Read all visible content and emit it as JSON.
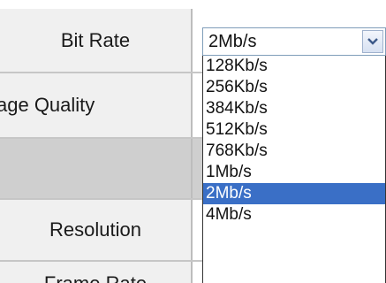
{
  "rows": {
    "bit_rate": {
      "label": "Bit Rate"
    },
    "image_quality": {
      "label": "age Quality"
    },
    "blank": {
      "label": ""
    },
    "resolution": {
      "label": "Resolution"
    },
    "frame_rate": {
      "label": "Frame Rate"
    }
  },
  "bit_rate_select": {
    "value": "2Mb/s",
    "options": [
      "128Kb/s",
      "256Kb/s",
      "384Kb/s",
      "512Kb/s",
      "768Kb/s",
      "1Mb/s",
      "2Mb/s",
      "4Mb/s"
    ],
    "selected_index": 6
  },
  "colors": {
    "selected_option_bg": "#3a6fc6",
    "label_bg": "#f0f0f0",
    "grey_row_bg": "#cfcfcf"
  },
  "icons": {
    "select_arrow": "chevron-down-icon"
  }
}
